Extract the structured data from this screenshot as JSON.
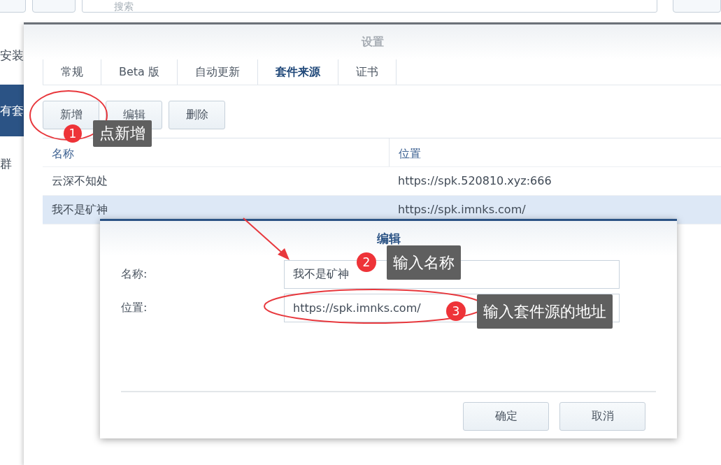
{
  "toolbar": {
    "search": {
      "placeholder": "搜索"
    }
  },
  "sidebar": {
    "items": [
      {
        "label": "安装",
        "selected": false
      },
      {
        "label": "有套",
        "selected": true
      },
      {
        "label": "群",
        "selected": false
      }
    ]
  },
  "settings": {
    "title": "设置",
    "tabs": [
      {
        "label": "常规",
        "selected": false
      },
      {
        "label": "Beta 版",
        "selected": false
      },
      {
        "label": "自动更新",
        "selected": false
      },
      {
        "label": "套件来源",
        "selected": true
      },
      {
        "label": "证书",
        "selected": false
      }
    ],
    "buttons": [
      "新增",
      "编辑",
      "删除"
    ],
    "table": {
      "columns": [
        "名称",
        "位置"
      ],
      "rows": [
        {
          "name": "云深不知处",
          "location": "https://spk.520810.xyz:666",
          "selected": false
        },
        {
          "name": "我不是矿神",
          "location": "https://spk.imnks.com/",
          "selected": true
        }
      ]
    }
  },
  "edit_dialog": {
    "title": "编辑",
    "fields": [
      {
        "label": "名称:",
        "value": "我不是矿神"
      },
      {
        "label": "位置:",
        "value": "https://spk.imnks.com/"
      }
    ],
    "buttons": [
      "确定",
      "取消"
    ]
  },
  "annotations": [
    {
      "number": "1",
      "text": "点新增"
    },
    {
      "number": "2",
      "text": "输入名称"
    },
    {
      "number": "3",
      "text": "输入套件源的地址"
    }
  ]
}
